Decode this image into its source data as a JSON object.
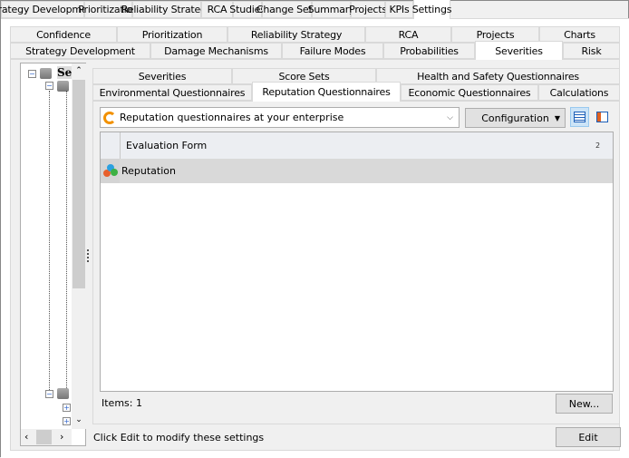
{
  "top_tabs": [
    "Strategy Development",
    "Prioritization",
    "Reliability Strategy",
    "RCA",
    "Studies",
    "Change Sets",
    "Summary",
    "Projects",
    "KPIs",
    "Settings"
  ],
  "settings_tabs_row1": [
    "Confidence",
    "Prioritization",
    "Reliability Strategy",
    "RCA",
    "Projects",
    "Charts"
  ],
  "settings_tabs_row2": [
    "Strategy Development",
    "Damage Mechanisms",
    "Failure Modes",
    "Probabilities",
    "Severities",
    "Risk"
  ],
  "tree": {
    "root_label": "Se"
  },
  "sev_tabs_row1": [
    "Severities",
    "Score Sets",
    "Health and Safety Questionnaires"
  ],
  "sev_tabs_row2": [
    "Environmental Questionnaires",
    "Reputation Questionnaires",
    "Economic Questionnaires",
    "Calculations"
  ],
  "dropdown": {
    "value": "Reputation questionnaires at your enterprise"
  },
  "config_button": "Configuration",
  "grid": {
    "header": "Evaluation Form",
    "sort_badge": "2",
    "rows": [
      "Reputation"
    ]
  },
  "items_label": "Items: 1",
  "new_button": "New...",
  "status": "Click Edit to modify these settings",
  "edit_button": "Edit"
}
